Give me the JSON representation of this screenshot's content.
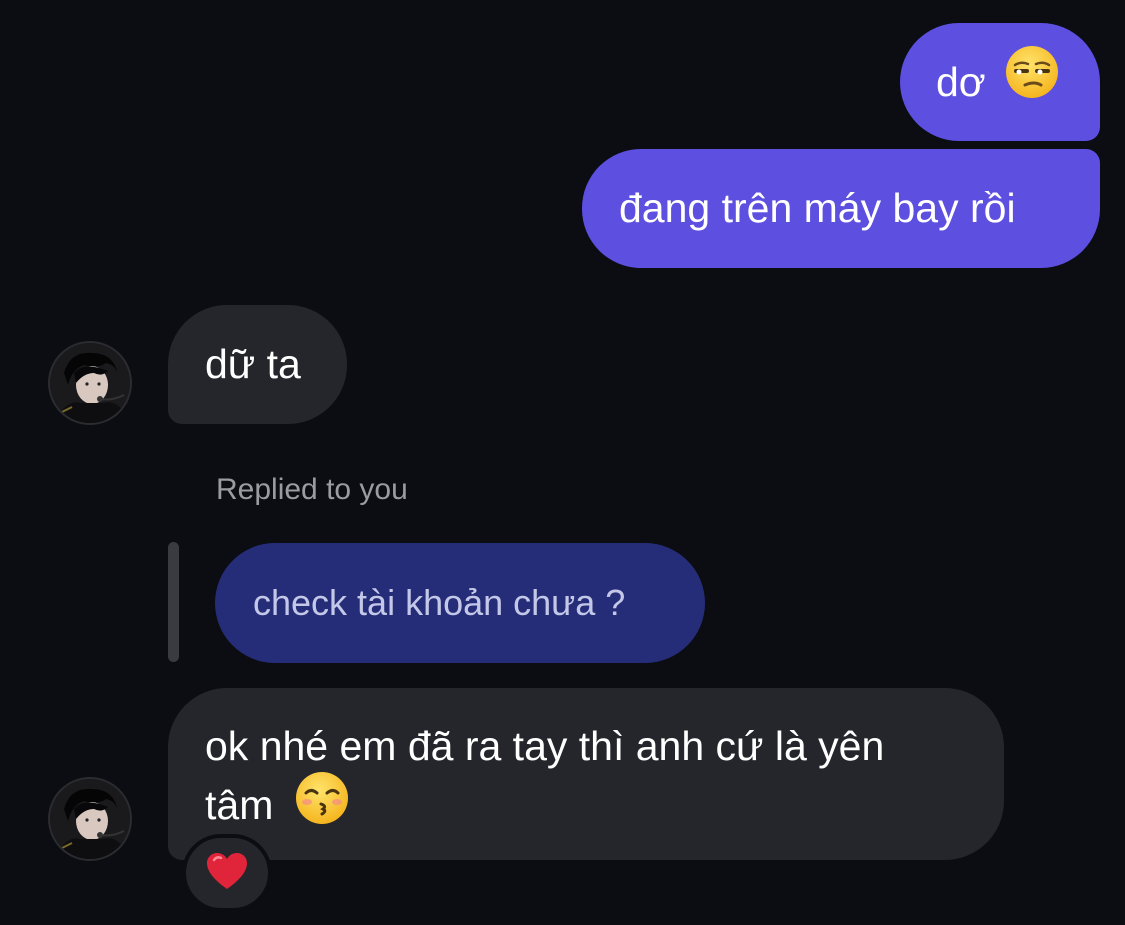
{
  "messages": {
    "out_1": {
      "text": "dơ",
      "emoji": "unamused-face-emoji"
    },
    "out_2": {
      "text": "đang trên máy bay rồi"
    },
    "in_1": {
      "text": "dữ ta"
    },
    "reply": {
      "label": "Replied to you",
      "quoted_text": "check tài khoản chưa ?"
    },
    "in_2": {
      "line1": "ok nhé em đã ra tay thì anh cứ là yên",
      "line2": "tâm",
      "emoji": "kissing-face-emoji",
      "reaction": "red-heart-emoji"
    }
  },
  "avatar": {
    "icon": "user-avatar-icon"
  },
  "colors": {
    "background": "#0b0d12",
    "outgoing_bubble": "#5d4fe0",
    "incoming_bubble": "#25262b",
    "reply_bubble": "#262d78",
    "reply_text": "#c4c8e8",
    "muted_text": "#9a9ca3"
  }
}
